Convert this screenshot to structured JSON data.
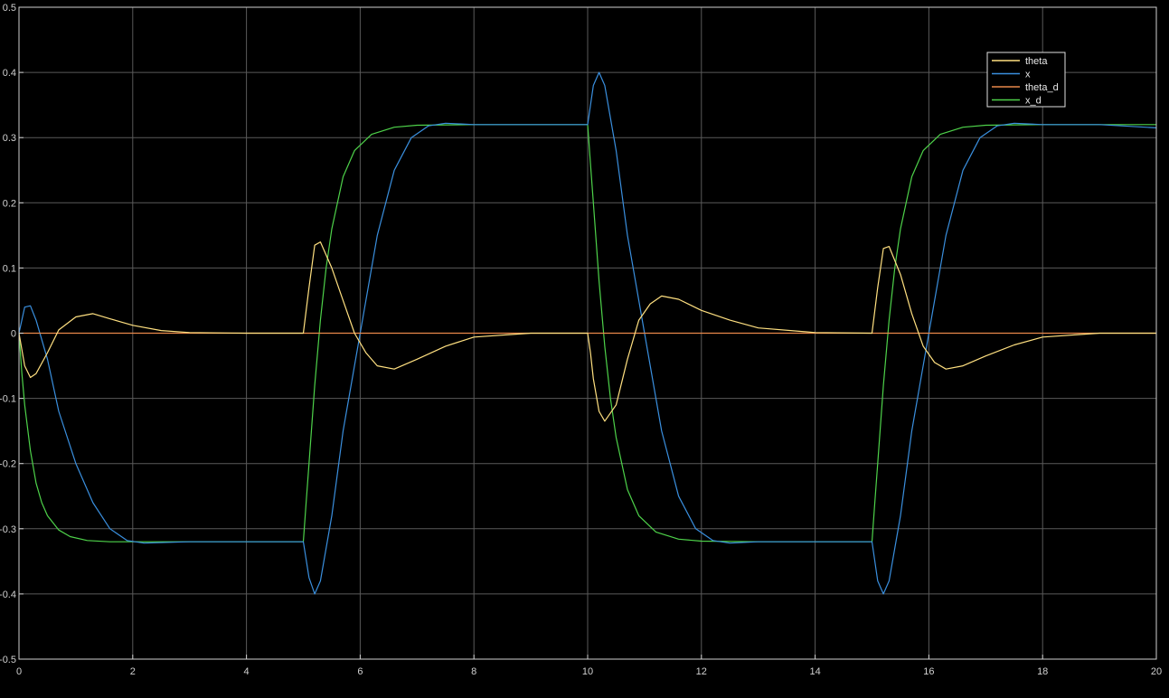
{
  "chart_data": {
    "type": "line",
    "title": "",
    "xlabel": "",
    "ylabel": "",
    "xlim": [
      0,
      20
    ],
    "ylim": [
      -0.5,
      0.5
    ],
    "x_ticks": [
      "0",
      "2",
      "4",
      "6",
      "8",
      "10",
      "12",
      "14",
      "16",
      "18",
      "20"
    ],
    "y_ticks": [
      "-0.5",
      "-0.4",
      "-0.3",
      "-0.2",
      "-0.1",
      "0",
      "0.1",
      "0.2",
      "0.3",
      "0.4",
      "0.5"
    ],
    "grid": true,
    "legend_position": "top-right",
    "background": "#000000",
    "axis_color": "#d0d0d0",
    "grid_color": "#5a5a5a",
    "series": [
      {
        "name": "theta",
        "color": "#ffe080",
        "x": [
          0,
          0.1,
          0.2,
          0.3,
          0.5,
          0.7,
          1.0,
          1.3,
          1.6,
          2.0,
          2.5,
          3.0,
          4.0,
          4.6,
          5.0,
          5.1,
          5.2,
          5.3,
          5.5,
          5.7,
          5.9,
          6.1,
          6.3,
          6.6,
          7.0,
          7.5,
          8.0,
          9.0,
          10.0,
          10.05,
          10.1,
          10.2,
          10.3,
          10.5,
          10.7,
          10.9,
          11.1,
          11.3,
          11.6,
          12.0,
          12.5,
          13.0,
          14.0,
          15.0,
          15.1,
          15.2,
          15.3,
          15.5,
          15.7,
          15.9,
          16.1,
          16.3,
          16.6,
          17.0,
          17.5,
          18.0,
          19.0,
          20.0
        ],
        "values": [
          0,
          -0.05,
          -0.068,
          -0.062,
          -0.03,
          0.005,
          0.025,
          0.03,
          0.022,
          0.012,
          0.004,
          0.001,
          0,
          0,
          0,
          0.07,
          0.135,
          0.14,
          0.1,
          0.05,
          0.0,
          -0.03,
          -0.05,
          -0.055,
          -0.04,
          -0.02,
          -0.006,
          0,
          0,
          -0.03,
          -0.07,
          -0.12,
          -0.135,
          -0.11,
          -0.04,
          0.02,
          0.045,
          0.057,
          0.052,
          0.035,
          0.02,
          0.008,
          0.001,
          0,
          0.07,
          0.13,
          0.133,
          0.09,
          0.03,
          -0.02,
          -0.045,
          -0.055,
          -0.05,
          -0.035,
          -0.018,
          -0.006,
          0,
          0
        ]
      },
      {
        "name": "x",
        "color": "#3a8fde",
        "x": [
          0,
          0.1,
          0.2,
          0.3,
          0.5,
          0.7,
          1.0,
          1.3,
          1.6,
          1.9,
          2.2,
          3.0,
          4.0,
          5.0,
          5.1,
          5.2,
          5.3,
          5.5,
          5.7,
          6.0,
          6.3,
          6.6,
          6.9,
          7.2,
          7.5,
          8.0,
          9.0,
          10.0,
          10.1,
          10.2,
          10.3,
          10.5,
          10.7,
          11.0,
          11.3,
          11.6,
          11.9,
          12.2,
          12.5,
          13.0,
          14.0,
          15.0,
          15.1,
          15.2,
          15.3,
          15.5,
          15.7,
          16.0,
          16.3,
          16.6,
          16.9,
          17.2,
          17.5,
          18.0,
          19.0,
          20.0
        ],
        "values": [
          0,
          0.04,
          0.042,
          0.02,
          -0.04,
          -0.12,
          -0.2,
          -0.26,
          -0.3,
          -0.318,
          -0.322,
          -0.32,
          -0.32,
          -0.32,
          -0.375,
          -0.4,
          -0.38,
          -0.28,
          -0.15,
          0.0,
          0.15,
          0.25,
          0.3,
          0.318,
          0.322,
          0.32,
          0.32,
          0.32,
          0.38,
          0.4,
          0.38,
          0.28,
          0.15,
          0.0,
          -0.15,
          -0.25,
          -0.3,
          -0.318,
          -0.322,
          -0.32,
          -0.32,
          -0.32,
          -0.38,
          -0.4,
          -0.38,
          -0.28,
          -0.15,
          0.0,
          0.15,
          0.25,
          0.3,
          0.318,
          0.322,
          0.32,
          0.32,
          0.315
        ]
      },
      {
        "name": "theta_d",
        "color": "#e8884a",
        "x": [
          0,
          20
        ],
        "values": [
          0,
          0
        ]
      },
      {
        "name": "x_d",
        "color": "#4ed24a",
        "x": [
          0,
          0.05,
          0.1,
          0.2,
          0.3,
          0.4,
          0.5,
          0.7,
          0.9,
          1.2,
          1.6,
          2.0,
          3.0,
          4.0,
          5.0,
          5.05,
          5.1,
          5.2,
          5.3,
          5.4,
          5.5,
          5.7,
          5.9,
          6.2,
          6.6,
          7.0,
          8.0,
          9.0,
          10.0,
          10.05,
          10.1,
          10.2,
          10.3,
          10.4,
          10.5,
          10.7,
          10.9,
          11.2,
          11.6,
          12.0,
          13.0,
          14.0,
          15.0,
          15.05,
          15.1,
          15.2,
          15.3,
          15.4,
          15.5,
          15.7,
          15.9,
          16.2,
          16.6,
          17.0,
          18.0,
          19.0,
          20.0
        ],
        "values": [
          0,
          -0.06,
          -0.11,
          -0.18,
          -0.23,
          -0.26,
          -0.28,
          -0.302,
          -0.312,
          -0.318,
          -0.32,
          -0.32,
          -0.32,
          -0.32,
          -0.32,
          -0.26,
          -0.2,
          -0.08,
          0.02,
          0.1,
          0.16,
          0.24,
          0.28,
          0.305,
          0.316,
          0.319,
          0.32,
          0.32,
          0.32,
          0.26,
          0.2,
          0.08,
          -0.02,
          -0.1,
          -0.16,
          -0.24,
          -0.28,
          -0.305,
          -0.316,
          -0.319,
          -0.32,
          -0.32,
          -0.32,
          -0.26,
          -0.2,
          -0.08,
          0.02,
          0.1,
          0.16,
          0.24,
          0.28,
          0.305,
          0.316,
          0.319,
          0.32,
          0.32,
          0.32
        ]
      }
    ]
  }
}
